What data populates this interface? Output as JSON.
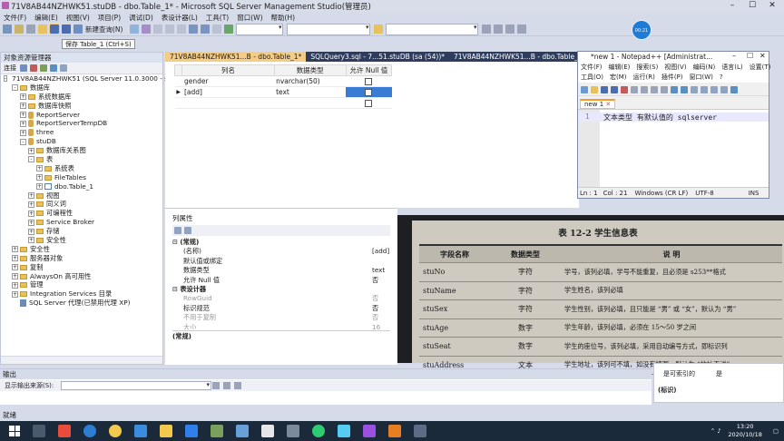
{
  "window": {
    "title": "71V8AB44NZHWK51.stuDB - dbo.Table_1* - Microsoft SQL Server Management Studio(管理员)",
    "avatar_text": "00:21"
  },
  "menu": [
    "文件(F)",
    "编辑(E)",
    "视图(V)",
    "项目(P)",
    "调试(D)",
    "表设计器(L)",
    "工具(T)",
    "窗口(W)",
    "帮助(H)"
  ],
  "toolbar": {
    "new_query": "新建查询(N)",
    "tooltip": "保存 Table_1 (Ctrl+S)"
  },
  "object_explorer": {
    "title": "对象资源管理器",
    "connect": "连接",
    "tree": [
      {
        "label": "71V8AB44NZHWK51 (SQL Server 11.0.3000 - sa",
        "level": 0,
        "icon": "server",
        "expander": "-"
      },
      {
        "label": "数据库",
        "level": 1,
        "icon": "folder",
        "expander": "-"
      },
      {
        "label": "系统数据库",
        "level": 2,
        "icon": "folder",
        "expander": "+"
      },
      {
        "label": "数据库快照",
        "level": 2,
        "icon": "folder",
        "expander": "+"
      },
      {
        "label": "ReportServer",
        "level": 2,
        "icon": "db",
        "expander": "+"
      },
      {
        "label": "ReportServerTempDB",
        "level": 2,
        "icon": "db",
        "expander": "+"
      },
      {
        "label": "three",
        "level": 2,
        "icon": "db",
        "expander": "+"
      },
      {
        "label": "stuDB",
        "level": 2,
        "icon": "db",
        "expander": "-"
      },
      {
        "label": "数据库关系图",
        "level": 3,
        "icon": "folder",
        "expander": "+"
      },
      {
        "label": "表",
        "level": 3,
        "icon": "folder",
        "expander": "-"
      },
      {
        "label": "系统表",
        "level": 4,
        "icon": "folder",
        "expander": "+"
      },
      {
        "label": "FileTables",
        "level": 4,
        "icon": "folder",
        "expander": "+"
      },
      {
        "label": "dbo.Table_1",
        "level": 4,
        "icon": "table",
        "expander": "+"
      },
      {
        "label": "视图",
        "level": 3,
        "icon": "folder",
        "expander": "+"
      },
      {
        "label": "同义词",
        "level": 3,
        "icon": "folder",
        "expander": "+"
      },
      {
        "label": "可编程性",
        "level": 3,
        "icon": "folder",
        "expander": "+"
      },
      {
        "label": "Service Broker",
        "level": 3,
        "icon": "folder",
        "expander": "+"
      },
      {
        "label": "存储",
        "level": 3,
        "icon": "folder",
        "expander": "+"
      },
      {
        "label": "安全性",
        "level": 3,
        "icon": "folder",
        "expander": "+"
      },
      {
        "label": "安全性",
        "level": 1,
        "icon": "folder",
        "expander": "+"
      },
      {
        "label": "服务器对象",
        "level": 1,
        "icon": "folder",
        "expander": "+"
      },
      {
        "label": "复制",
        "level": 1,
        "icon": "folder",
        "expander": "+"
      },
      {
        "label": "AlwaysOn 高可用性",
        "level": 1,
        "icon": "folder",
        "expander": "+"
      },
      {
        "label": "管理",
        "level": 1,
        "icon": "folder",
        "expander": "+"
      },
      {
        "label": "Integration Services 目录",
        "level": 1,
        "icon": "folder",
        "expander": "+"
      },
      {
        "label": "SQL Server 代理(已禁用代理 XP)",
        "level": 1,
        "icon": "agent",
        "expander": ""
      }
    ]
  },
  "tabs": [
    {
      "label": "71V8AB44NZHWK51...B - dbo.Table_1*",
      "active": true
    },
    {
      "label": "SQLQuery3.sql - 7...51.stuDB (sa (54))*",
      "active": false
    },
    {
      "label": "71V8AB44NZHWK51...B - dbo.Table_1",
      "active": false
    }
  ],
  "designer": {
    "headers": [
      "列名",
      "数据类型",
      "允许 Null 值"
    ],
    "rows": [
      {
        "indicator": "",
        "name": "gender",
        "type": "nvarchar(50)"
      },
      {
        "indicator": "▶",
        "name": "[add]",
        "type": "text"
      },
      {
        "indicator": "",
        "name": "",
        "type": ""
      }
    ]
  },
  "properties": {
    "title": "列属性",
    "groups": [
      {
        "name": "(常规)",
        "items": [
          {
            "name": "(名称)",
            "value": "[add]"
          },
          {
            "name": "默认值或绑定",
            "value": ""
          },
          {
            "name": "数据类型",
            "value": "text"
          },
          {
            "name": "允许 Null 值",
            "value": "否"
          }
        ]
      },
      {
        "name": "表设计器",
        "items": [
          {
            "name": "RowGuid",
            "value": "否"
          },
          {
            "name": "标识规范",
            "value": "否"
          },
          {
            "name": "不用于复制",
            "value": "否"
          },
          {
            "name": "大小",
            "value": "16"
          }
        ]
      }
    ],
    "footer": "(常规)"
  },
  "notepad": {
    "title": "*new 1 - Notepad++ [Administrat...",
    "menu1": [
      "文件(F)",
      "编辑(E)",
      "搜索(S)",
      "视图(V)",
      "编码(N)",
      "语言(L)",
      "设置(T)"
    ],
    "menu2": [
      "工具(O)",
      "宏(M)",
      "运行(R)",
      "插件(P)",
      "窗口(W)",
      "?"
    ],
    "tab": "new 1",
    "line_number": "1",
    "code": "文本类型 有默认值的 sqlserver",
    "status": [
      "Ln : 1",
      "Col : 21",
      "Windows (CR LF)",
      "UTF-8",
      "INS"
    ]
  },
  "photo_table": {
    "title": "表 12-2  学生信息表",
    "headers": [
      "字段名称",
      "数据类型",
      "说  明"
    ],
    "rows": [
      [
        "stuNo",
        "字符",
        "学号，该列必填，学号不能重复，且必须是 s253**格式"
      ],
      [
        "stuName",
        "字符",
        "学生姓名，该列必填"
      ],
      [
        "stuSex",
        "字符",
        "学生性别，该列必填，且只能是 “男” 或 “女”，默认为 “男”"
      ],
      [
        "stuAge",
        "数字",
        "学生年龄，该列必填，必须在 15～50 岁之间"
      ],
      [
        "stuSeat",
        "数字",
        "学生的座位号，该列必填，采用自动编号方式，即标识列"
      ],
      [
        "stuAddress",
        "文本",
        "学生地址，该列可不填，如没有填写，默认为 “地址不详”"
      ]
    ]
  },
  "right_lower": {
    "label": "是可索引的",
    "value": "是",
    "footer": "(标识)"
  },
  "output": {
    "title": "输出",
    "source_label": "显示输出来源(S):"
  },
  "status": {
    "text": "就绪"
  },
  "tray": {
    "time": "13:20",
    "date": "2020/10/18"
  }
}
